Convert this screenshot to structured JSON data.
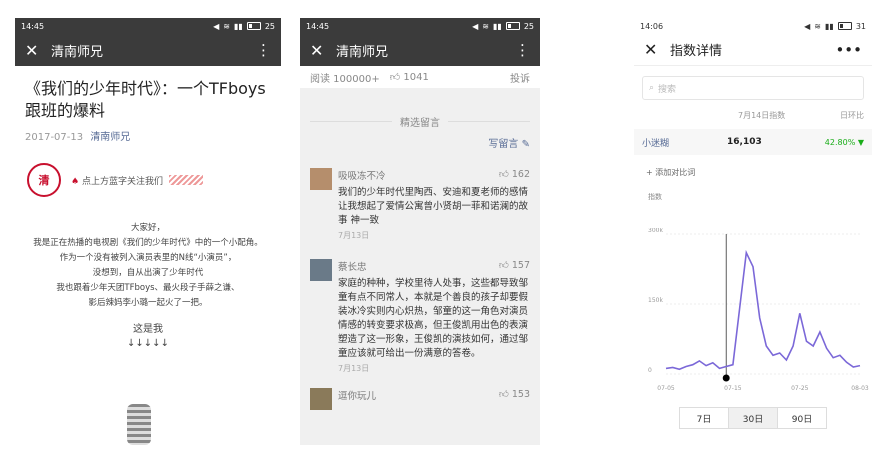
{
  "phone1": {
    "status": {
      "time": "14:45",
      "battery": "25"
    },
    "header": {
      "title": "清南师兄"
    },
    "article": {
      "title": "《我们的少年时代》：一个TFboys跟班的爆料",
      "date": "2017-07-13",
      "account": "清南师兄",
      "banner_text": "点上方蓝字关注我们",
      "logo_text": "清",
      "body": [
        "大家好，",
        "我是正在热播的电视剧《我们的少年时代》中的一个小配角。",
        "作为一个没有被列入演员表里的N线“小演员”，",
        "没想到，自从出演了少年时代",
        "我也跟着少年天团TFboys、最火段子手薛之谦、",
        "影后辣妈李小璐一起火了一把。"
      ],
      "this_is_me": "这是我",
      "arrows": "↓↓↓↓↓"
    }
  },
  "phone2": {
    "status": {
      "time": "14:45",
      "battery": "25"
    },
    "header": {
      "title": "清南师兄"
    },
    "stats": {
      "reads": "阅读 100000+",
      "likes": "1041",
      "report": "投诉"
    },
    "selected_label": "精选留言",
    "write_label": "写留言",
    "comments": [
      {
        "name": "吸吸冻不冷",
        "likes": "162",
        "text": "我们的少年时代里陶西、安迪和夏老师的感情让我想起了爱情公寓曾小贤胡一菲和诺澜的故事 神一致",
        "date": "7月13日"
      },
      {
        "name": "蔡长忠",
        "likes": "157",
        "text": "家庭的种种，学校里待人处事，这些都导致邹童有点不同常人，本就是个善良的孩子却要假装冰冷实则内心炽热，邹童的这一角色对演员情感的转变要求极高，但王俊凯用出色的表演塑造了这一形象，王俊凯的演技如何，通过邹童应该就可给出一份满意的答卷。",
        "date": "7月13日"
      },
      {
        "name": "逗你玩儿",
        "likes": "153"
      }
    ]
  },
  "phone3": {
    "status": {
      "time": "14:06",
      "battery": "31"
    },
    "header": {
      "title": "指数详情"
    },
    "search_placeholder": "搜索",
    "col_date": "7月14日指数",
    "col_change": "日环比",
    "keyword": {
      "name": "小迷糊",
      "value": "16,103",
      "change": "42.80% ▼"
    },
    "add_compare": "+ 添加对比词",
    "periods": [
      "7日",
      "30日",
      "90日"
    ],
    "colors": {
      "line": "#7b68d8",
      "up": "#1aad19",
      "link": "#576b95"
    }
  },
  "chart_data": {
    "type": "line",
    "ylabel": "指数",
    "yticks": [
      "300k",
      "150k",
      "0"
    ],
    "ylim": [
      0,
      300000
    ],
    "xticks": [
      "07-05",
      "07-15",
      "07-25",
      "08-03"
    ],
    "x": [
      "07-05",
      "07-06",
      "07-07",
      "07-08",
      "07-09",
      "07-10",
      "07-11",
      "07-12",
      "07-13",
      "07-14",
      "07-15",
      "07-16",
      "07-17",
      "07-18",
      "07-19",
      "07-20",
      "07-21",
      "07-22",
      "07-23",
      "07-24",
      "07-25",
      "07-26",
      "07-27",
      "07-28",
      "07-29",
      "07-30",
      "07-31",
      "08-01",
      "08-02",
      "08-03"
    ],
    "values": [
      12000,
      14000,
      10000,
      16000,
      20000,
      28000,
      18000,
      24000,
      12000,
      16103,
      20000,
      140000,
      260000,
      230000,
      120000,
      60000,
      40000,
      45000,
      30000,
      60000,
      130000,
      70000,
      60000,
      90000,
      55000,
      35000,
      40000,
      25000,
      15000,
      18000
    ]
  }
}
